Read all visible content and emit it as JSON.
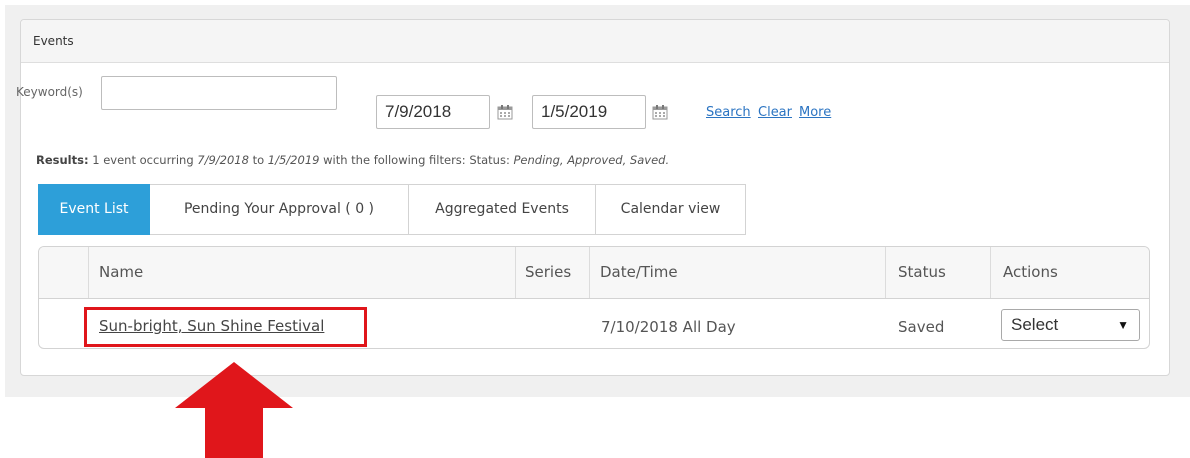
{
  "panel": {
    "title": "Events"
  },
  "filters": {
    "keyword_label": "Keyword(s)",
    "keyword_value": "",
    "start_date": "7/9/2018",
    "end_date": "1/5/2019",
    "search_link": "Search",
    "clear_link": "Clear",
    "more_link": "More"
  },
  "results": {
    "label": "Results:",
    "text_1": " 1 event occurring ",
    "from_date": "7/9/2018",
    "text_2": " to ",
    "to_date": "1/5/2019",
    "text_3": " with the following filters: Status: ",
    "statuses": "Pending, Approved, Saved."
  },
  "tabs": [
    {
      "label": "Event List",
      "active": true
    },
    {
      "label": "Pending Your Approval ( 0 )",
      "active": false
    },
    {
      "label": "Aggregated Events",
      "active": false
    },
    {
      "label": "Calendar view",
      "active": false
    }
  ],
  "table": {
    "headers": {
      "name": "Name",
      "series": "Series",
      "datetime": "Date/Time",
      "status": "Status",
      "actions": "Actions"
    },
    "rows": [
      {
        "name": "Sun-bright, Sun Shine Festival",
        "series": "",
        "datetime": "7/10/2018 All Day",
        "status": "Saved",
        "action_select": "Select"
      }
    ]
  },
  "colors": {
    "active_tab": "#2d9fd9",
    "link": "#2b74c2",
    "highlight": "#e0161b"
  },
  "icons": [
    "calendar-icon",
    "dropdown-arrow-icon",
    "up-arrow-annotation"
  ]
}
